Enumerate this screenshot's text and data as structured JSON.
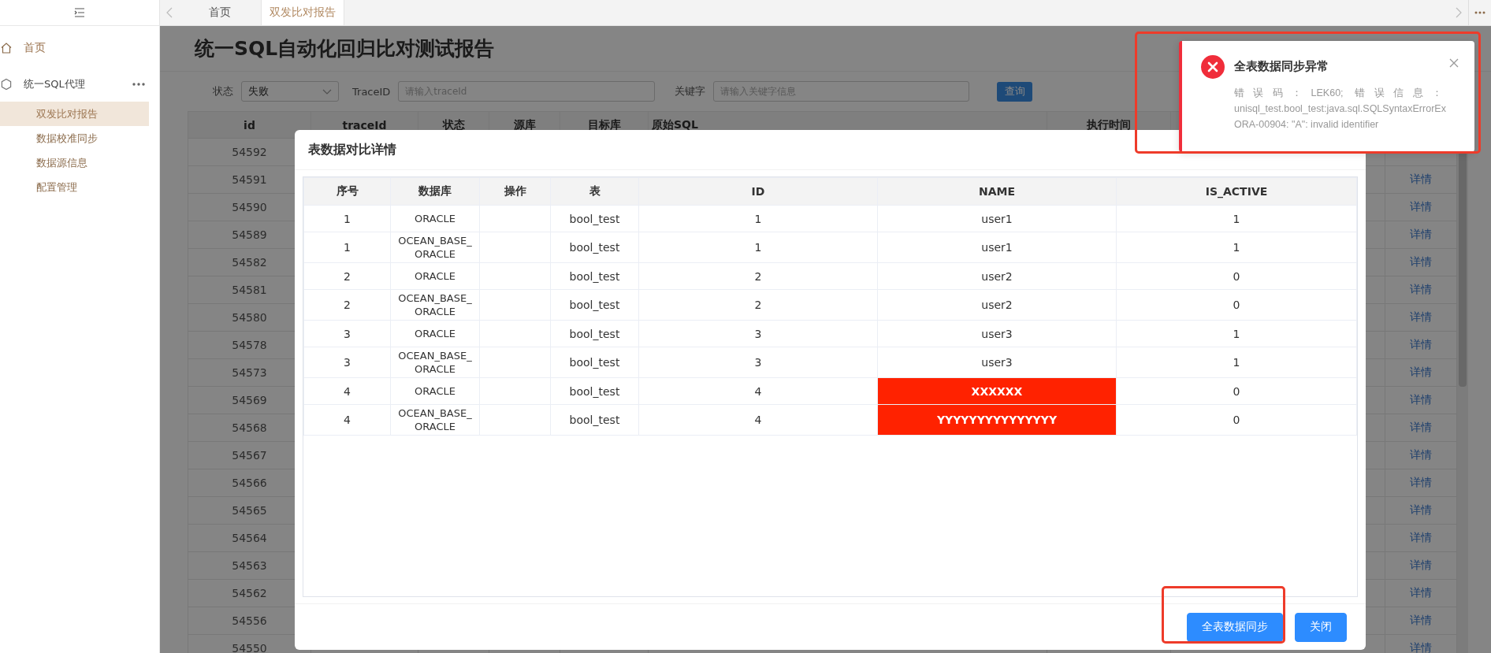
{
  "sidebar": {
    "items": [
      {
        "label": "首页",
        "kind": "home",
        "selected": false
      },
      {
        "label": "统一SQL代理",
        "kind": "group",
        "children": [
          {
            "label": "双发比对报告",
            "selected": true
          },
          {
            "label": "数据校准同步",
            "selected": false
          },
          {
            "label": "数据源信息",
            "selected": false
          },
          {
            "label": "配置管理",
            "selected": false
          }
        ]
      }
    ]
  },
  "tabs": [
    {
      "label": "首页",
      "selected": false
    },
    {
      "label": "双发比对报告",
      "selected": true
    }
  ],
  "page": {
    "title": "统一SQL自动化回归比对测试报告"
  },
  "filters": {
    "status": {
      "label": "状态",
      "value": "失败"
    },
    "trace": {
      "label": "TraceID",
      "placeholder": "请输入traceId"
    },
    "keyword": {
      "label": "关键字",
      "placeholder": "请输入关键字信息"
    },
    "search_button": "查询"
  },
  "table": {
    "columns": [
      "id",
      "traceId",
      "状态",
      "源库",
      "目标库",
      "原始SQL",
      "执行时间"
    ],
    "rows": [
      {
        "id": "54592"
      },
      {
        "id": "54591",
        "action": "详情"
      },
      {
        "id": "54590",
        "action": "详情"
      },
      {
        "id": "54589",
        "action": "详情"
      },
      {
        "id": "54582",
        "action": "详情"
      },
      {
        "id": "54581",
        "action": "详情"
      },
      {
        "id": "54580",
        "action": "详情"
      },
      {
        "id": "54578",
        "action": "详情"
      },
      {
        "id": "54573",
        "action": "详情"
      },
      {
        "id": "54569",
        "action": "详情"
      },
      {
        "id": "54568",
        "action": "详情"
      },
      {
        "id": "54567",
        "action": "详情"
      },
      {
        "id": "54566",
        "action": "详情"
      },
      {
        "id": "54565",
        "action": "详情"
      },
      {
        "id": "54564",
        "action": "详情"
      },
      {
        "id": "54563",
        "action": "详情"
      },
      {
        "id": "54562",
        "action": "详情"
      },
      {
        "id": "54556",
        "action": "详情"
      },
      {
        "id": "54550",
        "action": "详情"
      }
    ]
  },
  "modal": {
    "title": "表数据对比详情",
    "columns": [
      "序号",
      "数据库",
      "操作",
      "表",
      "ID",
      "NAME",
      "IS_ACTIVE"
    ],
    "rows": [
      {
        "seq": "1",
        "db": "ORACLE",
        "table": "bool_test",
        "id": "1",
        "name": "user1",
        "is_active": "1",
        "mismatch": false
      },
      {
        "seq": "1",
        "db": "OCEAN_BASE_ ORACLE",
        "table": "bool_test",
        "id": "1",
        "name": "user1",
        "is_active": "1",
        "mismatch": false
      },
      {
        "seq": "2",
        "db": "ORACLE",
        "table": "bool_test",
        "id": "2",
        "name": "user2",
        "is_active": "0",
        "mismatch": false
      },
      {
        "seq": "2",
        "db": "OCEAN_BASE_ ORACLE",
        "table": "bool_test",
        "id": "2",
        "name": "user2",
        "is_active": "0",
        "mismatch": false
      },
      {
        "seq": "3",
        "db": "ORACLE",
        "table": "bool_test",
        "id": "3",
        "name": "user3",
        "is_active": "1",
        "mismatch": false
      },
      {
        "seq": "3",
        "db": "OCEAN_BASE_ ORACLE",
        "table": "bool_test",
        "id": "3",
        "name": "user3",
        "is_active": "1",
        "mismatch": false
      },
      {
        "seq": "4",
        "db": "ORACLE",
        "table": "bool_test",
        "id": "4",
        "name": "XXXXXX",
        "is_active": "0",
        "mismatch": true
      },
      {
        "seq": "4",
        "db": "OCEAN_BASE_ ORACLE",
        "table": "bool_test",
        "id": "4",
        "name": "YYYYYYYYYYYYYYY",
        "is_active": "0",
        "mismatch": true
      }
    ],
    "buttons": [
      {
        "label": "全表数据同步",
        "kind": "primary"
      },
      {
        "label": "关闭",
        "kind": "primary"
      }
    ]
  },
  "notification": {
    "kind": "error",
    "title": "全表数据同步异常",
    "lines": [
      "错误码：LEK60; 错误信息：",
      "unisql_test.bool_test:java.sql.SQLSyntaxErrorEx",
      "ORA-00904: \"A\": invalid identifier"
    ]
  }
}
